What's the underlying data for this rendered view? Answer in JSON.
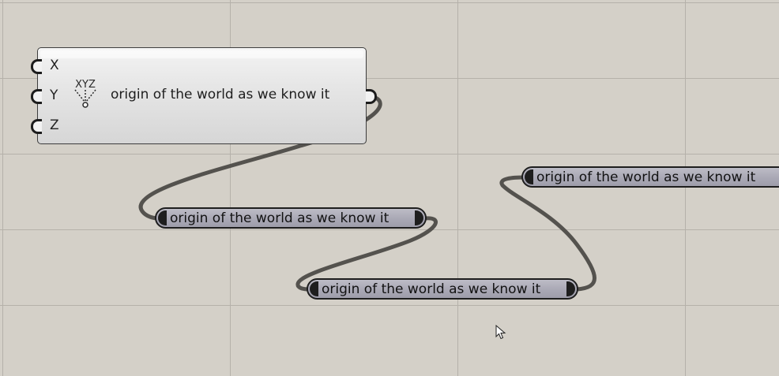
{
  "canvas": {
    "background": "#d4d0c8",
    "grid_color": "#b5b1aa",
    "wire_color": "#54524e"
  },
  "component": {
    "inputs": [
      "X",
      "Y",
      "Z"
    ],
    "icon": "xyz-point-icon",
    "icon_letters": "XYZ",
    "name": "origin of the world as we know it"
  },
  "relays": [
    {
      "label": "origin of the world as we know it"
    },
    {
      "label": "origin of the world as we know it"
    },
    {
      "label": "origin of the world as we know it"
    }
  ],
  "cursor": {
    "icon": "mouse-pointer-icon"
  }
}
